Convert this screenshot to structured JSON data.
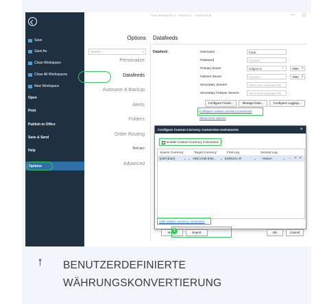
{
  "window": {
    "title": "New Workspace 1 - Desktop 1 - Tradovateal",
    "minimize": "—",
    "maximize": "☐"
  },
  "sidebar": {
    "items": [
      {
        "label": "Save"
      },
      {
        "label": "Save As"
      },
      {
        "label": "Close Workspace"
      },
      {
        "label": "Close All Workspaces"
      },
      {
        "label": "New Workspace"
      },
      {
        "label": "Open"
      },
      {
        "label": "Print"
      },
      {
        "label": "Publish to Office"
      },
      {
        "label": "Save & Send"
      },
      {
        "label": "Help"
      },
      {
        "label": "Options"
      }
    ]
  },
  "options_nav": {
    "header": "Options",
    "search_placeholder": "Search...",
    "items": [
      {
        "label": "Personalize"
      },
      {
        "label": "Datafeeds"
      },
      {
        "label": "Autosave & Backup"
      },
      {
        "label": "Alerts"
      },
      {
        "label": "Folders"
      },
      {
        "label": "Order Routing"
      },
      {
        "label": "Test acc"
      },
      {
        "label": "Advanced"
      }
    ]
  },
  "content": {
    "title": "Datafeeds",
    "section_label": "Datafeed",
    "fields": {
      "username_label": "Username",
      "username_value": "hanja",
      "password_label": "Password",
      "password_placeholder": "Optional",
      "primary_label": "Primary Server",
      "primary_value": "mdgs11.w",
      "primary_port": "7800",
      "failover_label": "Failover Server",
      "failover_placeholder": "Optional",
      "failover_port": "7800",
      "secondary_label": "Secondary Servers",
      "secondary_placeholder": "Semi-colon separated list",
      "secfail_label": "Secondary Failover Servers",
      "secfail_placeholder": "Semi-colon separated list"
    },
    "buttons": {
      "configure_feeds": "Configure Feeds...",
      "manage_data": "Manage Data...",
      "configure_logging": "Configure Logging..."
    },
    "links": {
      "custom_currency": "Configure custom currency conversion",
      "show_more": "Show more options"
    }
  },
  "dialog": {
    "title": "Configure Custom Currency Conversion Instruments",
    "close": "✕",
    "enable_label": "Enable Custom Currency Conversion",
    "enable_checked": "✓",
    "help": "?",
    "columns": [
      "Source Currency",
      "Target Currency",
      "First Leg",
      "Second Leg"
    ],
    "row": {
      "source": "EUR (Euro)",
      "target": "AED (Arab Emir...",
      "first_leg": "EURCUC=R",
      "second_leg": "<None>"
    },
    "add_link": "Add custom currency conversion",
    "import": "Import",
    "export": "Export",
    "ok": "OK",
    "cancel": "Cancel"
  },
  "annotation": {
    "step_number": "1"
  },
  "caption": {
    "arrow": "↑",
    "line1": "BENUTZERDEFINIERTE",
    "line2": "WÄHRUNGSKONVERTIERUNG"
  }
}
